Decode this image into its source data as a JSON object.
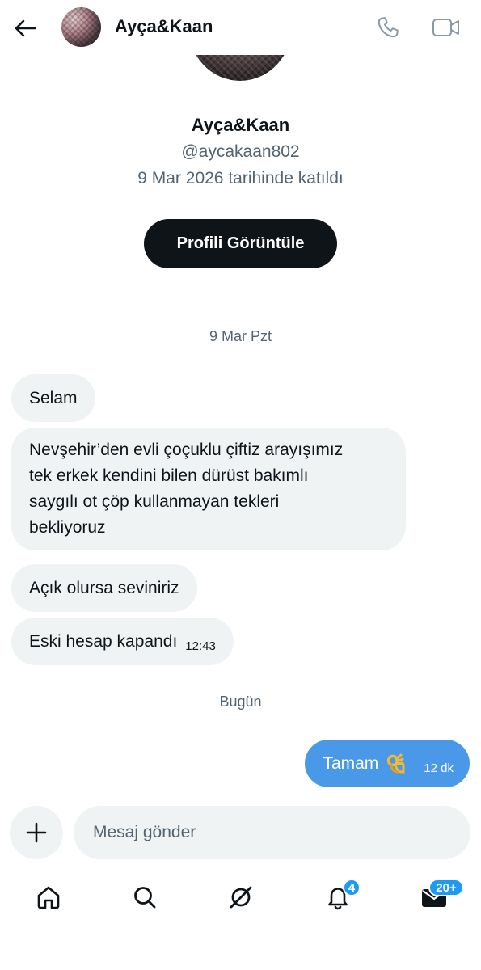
{
  "header": {
    "name": "Ayça&Kaan",
    "icons": {
      "back": "arrow-left-icon",
      "call": "phone-icon",
      "video": "video-icon"
    }
  },
  "profile": {
    "name": "Ayça&Kaan",
    "handle": "@aycakaan802",
    "joined": "9 Mar 2026 tarihinde katıldı",
    "view_button": "Profili Görüntüle"
  },
  "conversation": {
    "date_separator_1": "9 Mar Pzt",
    "received": [
      {
        "text": "Selam"
      },
      {
        "lines": [
          "Nevşehir’den evli çoçuklu çiftiz arayışımız",
          "tek erkek kendini bilen dürüst bakımlı",
          "saygılı ot çöp kullanmayan tekleri",
          "bekliyoruz"
        ]
      },
      {
        "text": "Açık olursa seviniriz"
      },
      {
        "text": "Eski hesap kapandı",
        "time": "12:43"
      }
    ],
    "date_separator_2": "Bugün",
    "sent": [
      {
        "text": "Tamam",
        "emoji": "ok-hand-emoji",
        "time": "12 dk"
      }
    ]
  },
  "composer": {
    "placeholder": "Mesaj gönder",
    "add_icon": "plus-icon"
  },
  "bottom_nav": {
    "items": [
      {
        "icon": "home-icon"
      },
      {
        "icon": "search-icon"
      },
      {
        "icon": "grok-icon"
      },
      {
        "icon": "bell-icon",
        "badge": "4"
      },
      {
        "icon": "mail-icon",
        "badge": "20+"
      }
    ]
  },
  "colors": {
    "accent": "#1d9bf0",
    "sent_bubble": "#4a99e9",
    "received_bubble": "#eff3f4",
    "text": "#0f1419",
    "muted": "#536471"
  }
}
